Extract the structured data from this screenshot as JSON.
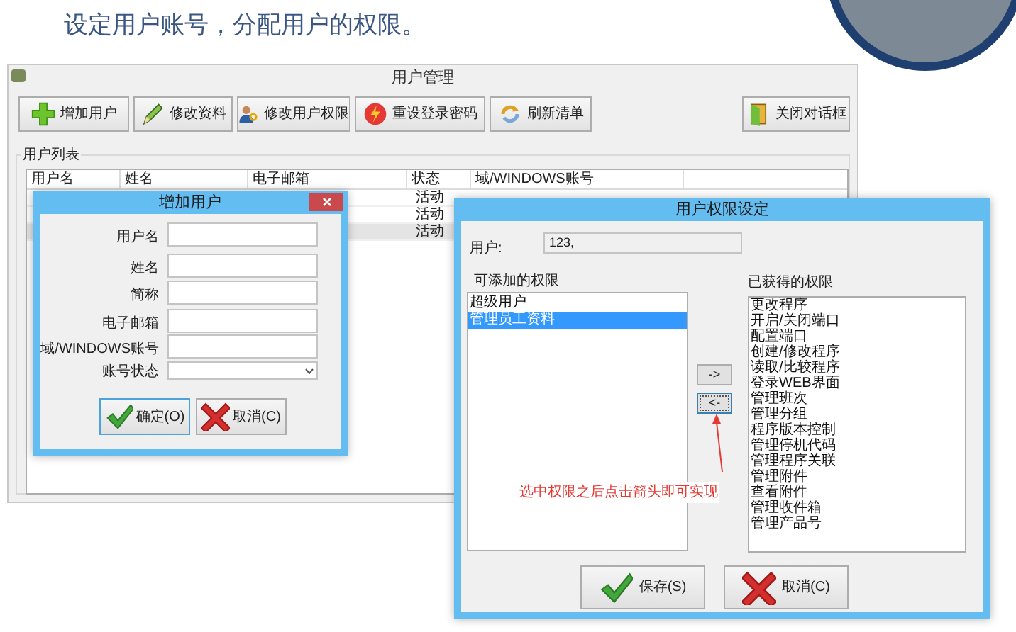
{
  "slide": {
    "heading": "设定用户账号，分配用户的权限。"
  },
  "main_window": {
    "title": "用户管理",
    "toolbar": [
      {
        "label": "增加用户",
        "kind": "add"
      },
      {
        "label": "修改资料",
        "kind": "edit"
      },
      {
        "label": "修改用户权限",
        "kind": "user"
      },
      {
        "label": "重设登录密码",
        "kind": "reset"
      },
      {
        "label": "刷新清单",
        "kind": "refresh"
      },
      {
        "label": "关闭对话框",
        "kind": "close"
      }
    ],
    "group_label": "用户列表",
    "table": {
      "columns": [
        "用户名",
        "姓名",
        "电子邮箱",
        "状态",
        "域/WINDOWS账号"
      ],
      "rows": [
        {
          "status": "活动",
          "selected": false
        },
        {
          "status": "活动",
          "selected": false
        },
        {
          "status": "活动",
          "selected": true
        }
      ]
    }
  },
  "add_user_dialog": {
    "title": "增加用户",
    "fields": [
      {
        "label": "用户名",
        "kind": "text"
      },
      {
        "label": "姓名",
        "kind": "text"
      },
      {
        "label": "简称",
        "kind": "text"
      },
      {
        "label": "电子邮箱",
        "kind": "text"
      },
      {
        "label": "域/WINDOWS账号",
        "kind": "text"
      },
      {
        "label": "账号状态",
        "kind": "select"
      }
    ],
    "buttons": [
      {
        "label": "确定(O)",
        "kind": "ok",
        "focused": true
      },
      {
        "label": "取消(C)",
        "kind": "cancel",
        "focused": false
      }
    ]
  },
  "permissions_dialog": {
    "title": "用户权限设定",
    "user_label": "用户:",
    "user_value": "123,",
    "available_label": "可添加的权限",
    "available": [
      {
        "label": "超级用户",
        "selected": false
      },
      {
        "label": "管理员工资料",
        "selected": true
      }
    ],
    "move_buttons": [
      {
        "label": "->",
        "focused": false
      },
      {
        "label": "<-",
        "focused": true
      }
    ],
    "granted_label": "已获得的权限",
    "granted": [
      "更改程序",
      "开启/关闭端口",
      "配置端口",
      "创建/修改程序",
      "读取/比较程序",
      "登录WEB界面",
      "管理班次",
      "管理分组",
      "程序版本控制",
      "管理停机代码",
      "管理程序关联",
      "管理附件",
      "查看附件",
      "管理收件箱",
      "管理产品号"
    ],
    "annotation": "选中权限之后点击箭头即可实现",
    "buttons": [
      {
        "label": "保存(S)",
        "kind": "ok"
      },
      {
        "label": "取消(C)",
        "kind": "cancel"
      }
    ]
  }
}
